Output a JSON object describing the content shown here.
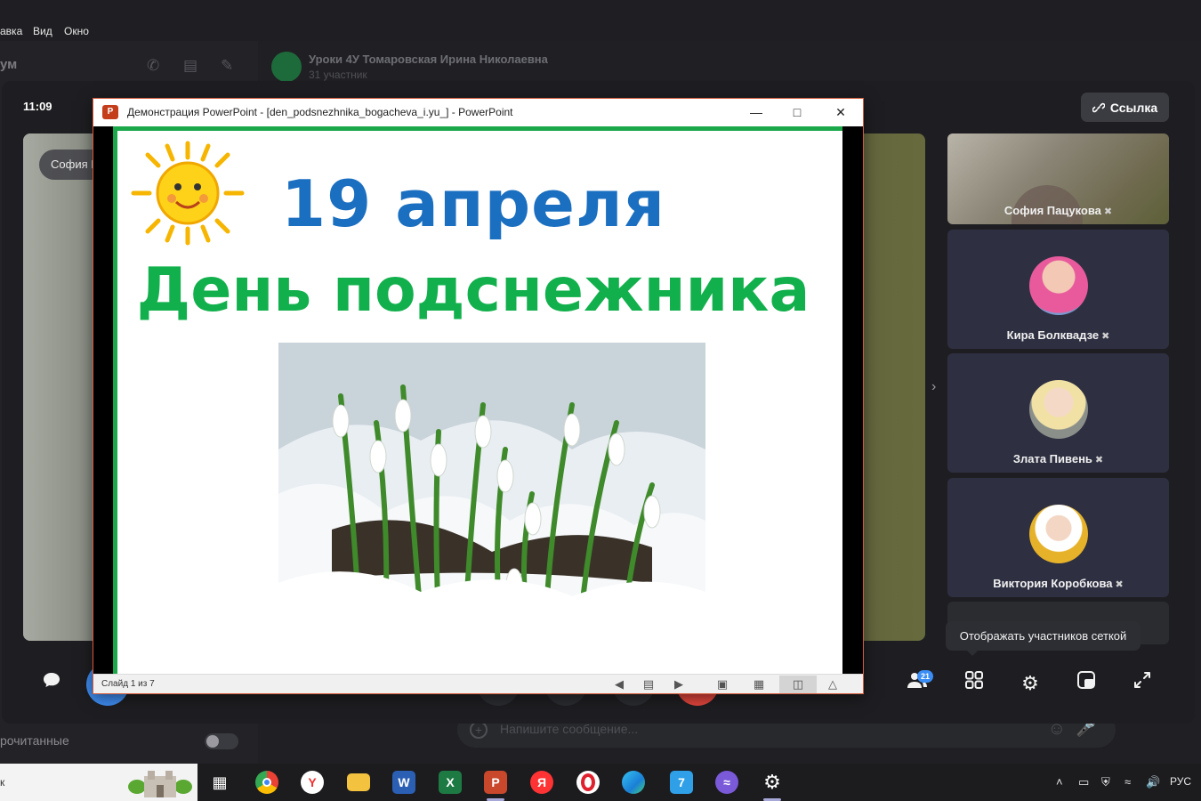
{
  "menu": {
    "items": [
      "авка",
      "Вид",
      "Окно"
    ]
  },
  "background_app": {
    "left_title": "ум",
    "chat_title": "Уроки 4У Томаровская Ирина Николаевна",
    "chat_subtitle": "31 участник",
    "unread_label": "рочитанные",
    "message_placeholder": "Напишите сообщение..."
  },
  "call": {
    "time": "11:09",
    "link_button": "Ссылка",
    "main_video_name": "София П",
    "participants_badge": "21",
    "tooltip": "Отображать участников сеткой",
    "participants": [
      {
        "name": "София Пацукова",
        "mic": "muted"
      },
      {
        "name": "Кира Болквадзе",
        "mic": "muted"
      },
      {
        "name": "Злата Пивень",
        "mic": "muted"
      },
      {
        "name": "Виктория Коробкова",
        "mic": "muted"
      }
    ]
  },
  "powerpoint": {
    "window_title": "Демонстрация PowerPoint - [den_podsnezhnika_bogacheva_i.yu_] - PowerPoint",
    "slide_date": "19 апреля",
    "slide_title": "День подснежника",
    "status": "Слайд 1 из 7"
  },
  "taskbar": {
    "search_text": "к",
    "language": "РУС",
    "icons": [
      "task-view",
      "chrome",
      "yandex-browser",
      "file-explorer",
      "word",
      "excel",
      "powerpoint",
      "yandex",
      "opera",
      "edge",
      "app-7",
      "purple-app",
      "settings"
    ]
  },
  "colors": {
    "slide_blue": "#1b6fc0",
    "slide_green": "#12b04c",
    "badge_blue": "#3a8df5",
    "end_call_red": "#e0453c"
  }
}
